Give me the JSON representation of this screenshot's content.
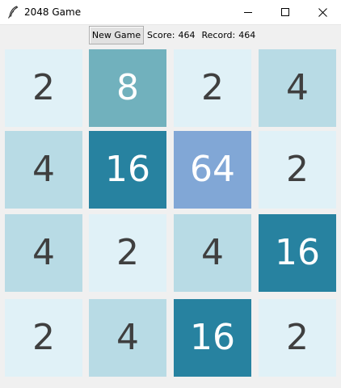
{
  "window": {
    "title": "2048 Game",
    "app_icon": "feather-icon",
    "controls": [
      "minimize-icon",
      "maximize-icon",
      "close-icon"
    ]
  },
  "toolbar": {
    "new_game_label": "New Game",
    "score_label": "Score:",
    "score_value": "464",
    "record_label": "Record:",
    "record_value": "464"
  },
  "board": {
    "rows": [
      [
        {
          "value": "2"
        },
        {
          "value": "8"
        },
        {
          "value": "2"
        },
        {
          "value": "4"
        }
      ],
      [
        {
          "value": "4"
        },
        {
          "value": "16"
        },
        {
          "value": "64"
        },
        {
          "value": "2"
        }
      ],
      [
        {
          "value": "4"
        },
        {
          "value": "2"
        },
        {
          "value": "4"
        },
        {
          "value": "16"
        }
      ],
      [
        {
          "value": "2"
        },
        {
          "value": "4"
        },
        {
          "value": "16"
        },
        {
          "value": "2"
        }
      ]
    ]
  },
  "tile_colors": {
    "2": {
      "bg": "#e0f1f7",
      "fg": "#3f3f3f"
    },
    "4": {
      "bg": "#b8dbe5",
      "fg": "#3f3f3f"
    },
    "8": {
      "bg": "#71b1bd",
      "fg": "#ffffff"
    },
    "16": {
      "bg": "#2782a0",
      "fg": "#ffffff"
    },
    "64": {
      "bg": "#81a7d6",
      "fg": "#ffffff"
    }
  }
}
